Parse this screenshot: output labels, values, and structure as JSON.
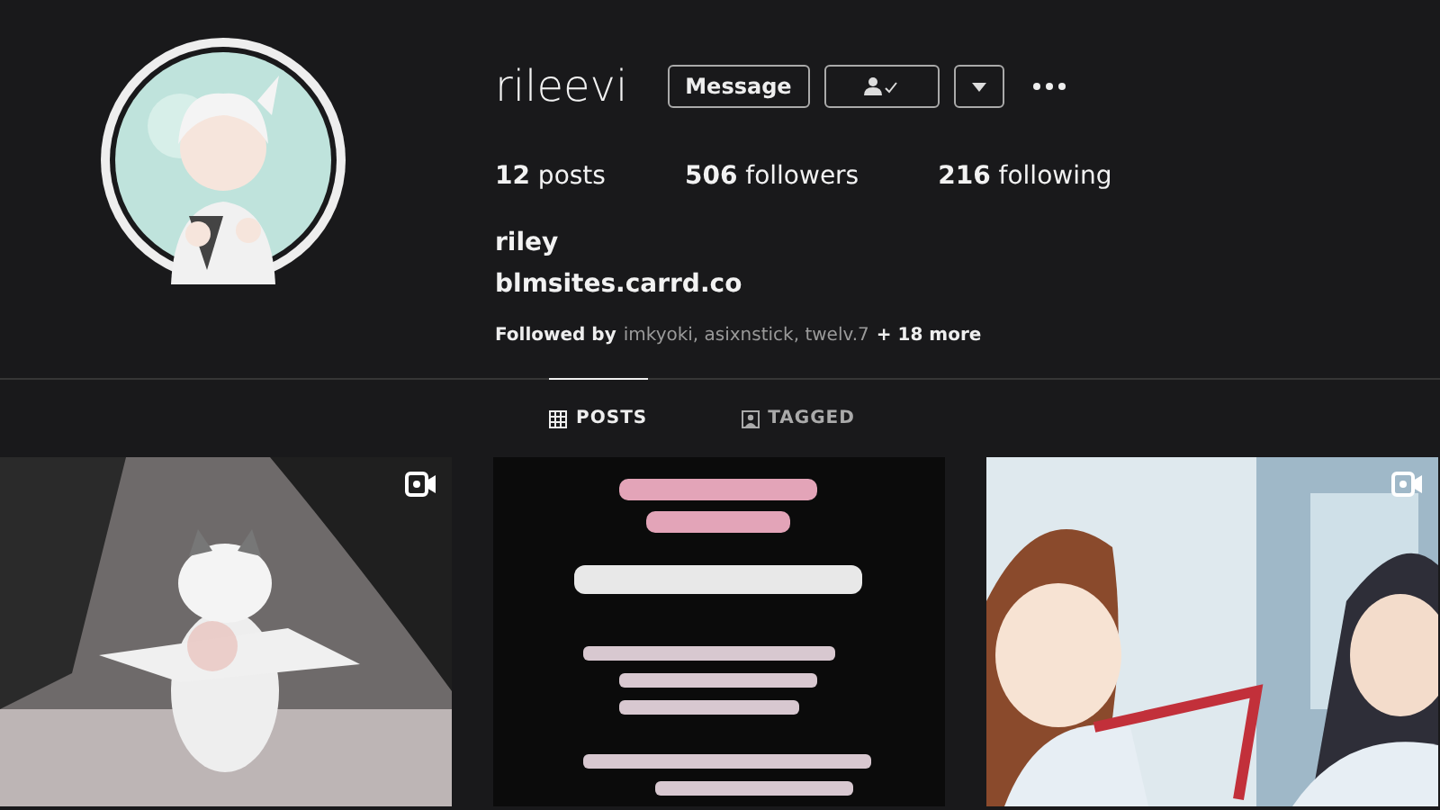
{
  "profile": {
    "username": "rileevi",
    "buttons": [
      {
        "kind": "text",
        "label": "Message"
      },
      {
        "kind": "following"
      },
      {
        "kind": "dropdown"
      },
      {
        "kind": "more"
      }
    ],
    "stats": [
      {
        "text": "**12** posts"
      },
      {
        "text": "**506** followers"
      },
      {
        "text": "**216** following"
      }
    ],
    "name": "riley",
    "link": "blmsites.carrd.co",
    "followed_by": {
      "prefix": "Followed by",
      "names": "imkyoki, asixnstick, twelv.7",
      "more": "+ 18 more"
    }
  },
  "tabs": [
    {
      "label": "POSTS",
      "selected": true
    },
    {
      "label": "TAGGED",
      "selected": false
    }
  ],
  "posts": [
    {
      "kind": "picture",
      "video": true
    },
    {
      "kind": "picture",
      "video": false
    },
    {
      "kind": "picture",
      "video": true
    }
  ]
}
